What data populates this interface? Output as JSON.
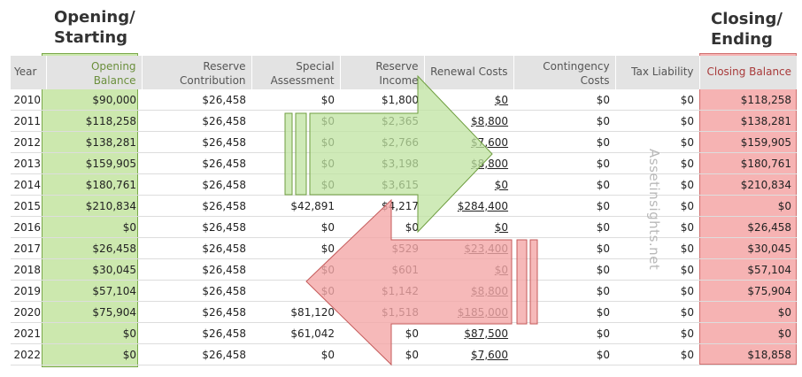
{
  "labels": {
    "opening_line1": "Opening/",
    "opening_line2": "Starting",
    "closing_line1": "Closing/",
    "closing_line2": "Ending"
  },
  "watermark": "Assetinsights.net",
  "colors": {
    "opening_highlight": "#cce8ae",
    "closing_highlight": "#f6b3b3"
  },
  "headers": {
    "year": "Year",
    "opening_1": "Opening",
    "opening_2": "Balance",
    "reserve_contrib_1": "Reserve",
    "reserve_contrib_2": "Contribution",
    "special_1": "Special",
    "special_2": "Assessment",
    "income_1": "Reserve",
    "income_2": "Income",
    "renewal": "Renewal Costs",
    "contingency_1": "Contingency",
    "contingency_2": "Costs",
    "tax": "Tax Liability",
    "closing": "Closing Balance"
  },
  "rows": [
    {
      "year": "2010",
      "opening": "$90,000",
      "contribution": "$26,458",
      "special": "$0",
      "income": "$1,800",
      "renewal": "$0",
      "contingency": "$0",
      "tax": "$0",
      "closing": "$118,258"
    },
    {
      "year": "2011",
      "opening": "$118,258",
      "contribution": "$26,458",
      "special": "$0",
      "income": "$2,365",
      "renewal": "$8,800",
      "contingency": "$0",
      "tax": "$0",
      "closing": "$138,281"
    },
    {
      "year": "2012",
      "opening": "$138,281",
      "contribution": "$26,458",
      "special": "$0",
      "income": "$2,766",
      "renewal": "$7,600",
      "contingency": "$0",
      "tax": "$0",
      "closing": "$159,905"
    },
    {
      "year": "2013",
      "opening": "$159,905",
      "contribution": "$26,458",
      "special": "$0",
      "income": "$3,198",
      "renewal": "$8,800",
      "contingency": "$0",
      "tax": "$0",
      "closing": "$180,761"
    },
    {
      "year": "2014",
      "opening": "$180,761",
      "contribution": "$26,458",
      "special": "$0",
      "income": "$3,615",
      "renewal": "$0",
      "contingency": "$0",
      "tax": "$0",
      "closing": "$210,834"
    },
    {
      "year": "2015",
      "opening": "$210,834",
      "contribution": "$26,458",
      "special": "$42,891",
      "income": "$4,217",
      "renewal": "$284,400",
      "contingency": "$0",
      "tax": "$0",
      "closing": "$0"
    },
    {
      "year": "2016",
      "opening": "$0",
      "contribution": "$26,458",
      "special": "$0",
      "income": "$0",
      "renewal": "$0",
      "contingency": "$0",
      "tax": "$0",
      "closing": "$26,458"
    },
    {
      "year": "2017",
      "opening": "$26,458",
      "contribution": "$26,458",
      "special": "$0",
      "income": "$529",
      "renewal": "$23,400",
      "contingency": "$0",
      "tax": "$0",
      "closing": "$30,045"
    },
    {
      "year": "2018",
      "opening": "$30,045",
      "contribution": "$26,458",
      "special": "$0",
      "income": "$601",
      "renewal": "$0",
      "contingency": "$0",
      "tax": "$0",
      "closing": "$57,104"
    },
    {
      "year": "2019",
      "opening": "$57,104",
      "contribution": "$26,458",
      "special": "$0",
      "income": "$1,142",
      "renewal": "$8,800",
      "contingency": "$0",
      "tax": "$0",
      "closing": "$75,904"
    },
    {
      "year": "2020",
      "opening": "$75,904",
      "contribution": "$26,458",
      "special": "$81,120",
      "income": "$1,518",
      "renewal": "$185,000",
      "contingency": "$0",
      "tax": "$0",
      "closing": "$0"
    },
    {
      "year": "2021",
      "opening": "$0",
      "contribution": "$26,458",
      "special": "$61,042",
      "income": "$0",
      "renewal": "$87,500",
      "contingency": "$0",
      "tax": "$0",
      "closing": "$0"
    },
    {
      "year": "2022",
      "opening": "$0",
      "contribution": "$26,458",
      "special": "$0",
      "income": "$0",
      "renewal": "$7,600",
      "contingency": "$0",
      "tax": "$0",
      "closing": "$18,858"
    }
  ]
}
